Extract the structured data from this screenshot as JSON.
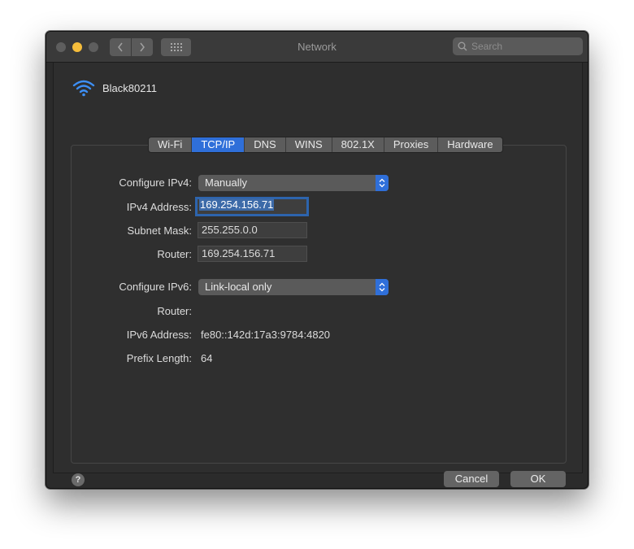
{
  "window": {
    "title": "Network",
    "search_placeholder": "Search"
  },
  "interface": {
    "name": "Black80211",
    "icon": "wifi-icon"
  },
  "tabs": [
    {
      "label": "Wi-Fi",
      "active": false
    },
    {
      "label": "TCP/IP",
      "active": true
    },
    {
      "label": "DNS",
      "active": false
    },
    {
      "label": "WINS",
      "active": false
    },
    {
      "label": "802.1X",
      "active": false
    },
    {
      "label": "Proxies",
      "active": false
    },
    {
      "label": "Hardware",
      "active": false
    }
  ],
  "ipv4": {
    "configure_label": "Configure IPv4:",
    "configure_value": "Manually",
    "address_label": "IPv4 Address:",
    "address_value": "169.254.156.71",
    "subnet_label": "Subnet Mask:",
    "subnet_value": "255.255.0.0",
    "router_label": "Router:",
    "router_value": "169.254.156.71"
  },
  "ipv6": {
    "configure_label": "Configure IPv6:",
    "configure_value": "Link-local only",
    "router_label": "Router:",
    "router_value": "",
    "address_label": "IPv6 Address:",
    "address_value": "fe80::142d:17a3:9784:4820",
    "prefix_label": "Prefix Length:",
    "prefix_value": "64"
  },
  "footer": {
    "help_symbol": "?",
    "cancel_label": "Cancel",
    "ok_label": "OK"
  },
  "colors": {
    "accent": "#2f6fd9",
    "window_bg": "#2b2b2b",
    "minimize": "#f6bd3b"
  }
}
